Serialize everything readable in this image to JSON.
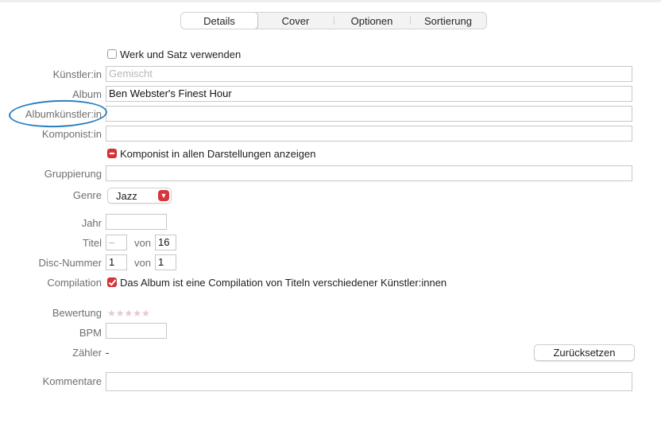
{
  "tabs": [
    "Details",
    "Cover",
    "Optionen",
    "Sortierung"
  ],
  "active_tab": "Details",
  "work_checkbox": {
    "label": "Werk und Satz verwenden",
    "checked": false
  },
  "fields": {
    "artist": {
      "label": "Künstler:in",
      "value": "",
      "placeholder": "Gemischt"
    },
    "album": {
      "label": "Album",
      "value": "Ben Webster's Finest Hour"
    },
    "album_artist": {
      "label": "Albumkünstler:in",
      "value": ""
    },
    "composer": {
      "label": "Komponist:in",
      "value": ""
    },
    "grouping": {
      "label": "Gruppierung",
      "value": ""
    },
    "genre": {
      "label": "Genre",
      "value": "Jazz"
    },
    "year": {
      "label": "Jahr",
      "value": ""
    },
    "track": {
      "label": "Titel",
      "number": "–",
      "of_label": "von",
      "total": "16"
    },
    "disc": {
      "label": "Disc-Nummer",
      "number": "1",
      "of_label": "von",
      "total": "1"
    },
    "compilation": {
      "label": "Compilation",
      "checkbox_label": "Das Album ist eine Compilation von Titeln verschiedener Künstler:innen",
      "checked": true
    },
    "rating": {
      "label": "Bewertung",
      "stars": "★★★★★",
      "value": 0
    },
    "bpm": {
      "label": "BPM",
      "value": ""
    },
    "play_count": {
      "label": "Zähler",
      "value": "-",
      "reset_button": "Zurücksetzen"
    },
    "comments": {
      "label": "Kommentare",
      "value": ""
    }
  },
  "composer_checkbox": {
    "label": "Komponist in allen Darstellungen anzeigen",
    "state": "mixed"
  },
  "colors": {
    "accent": "#d9343a",
    "annotation": "#2a7fc0"
  },
  "icons": {
    "genre_popup": "chevron-down-icon"
  }
}
